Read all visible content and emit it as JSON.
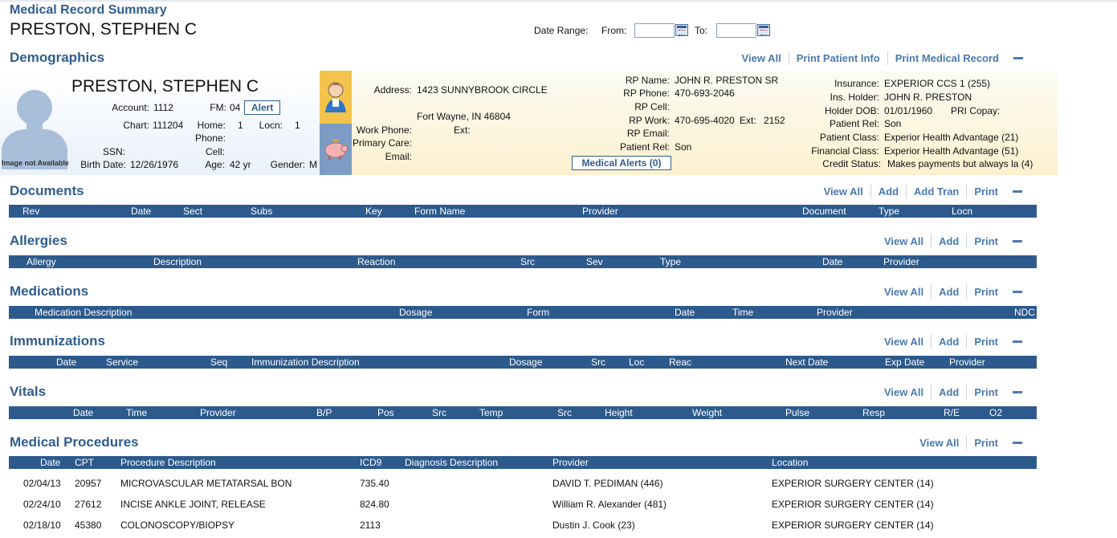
{
  "app_title": "Medical Record Summary",
  "patient_name": "PRESTON, STEPHEN C",
  "date_range": {
    "label": "Date Range:",
    "from_label": "From:",
    "to_label": "To:",
    "from_value": "",
    "to_value": ""
  },
  "demographics": {
    "title": "Demographics",
    "actions": [
      "View All",
      "Print Patient Info",
      "Print Medical Record"
    ],
    "photo_caption": "Image not Available",
    "name": "PRESTON, STEPHEN C",
    "account_label": "Account:",
    "account": "1112",
    "fm_label": "FM:",
    "fm": "04",
    "alert_button": "Alert",
    "chart_label": "Chart:",
    "chart": "111204",
    "home_phone_label": "Home:",
    "home_phone": "1",
    "phone_label": "Phone:",
    "locn_label": "Locn:",
    "locn": "1",
    "ssn_label": "SSN:",
    "ssn": "",
    "cell_label": "Cell:",
    "cell": "",
    "birth_date_label": "Birth Date:",
    "birth_date": "12/26/1976",
    "age_label": "Age:",
    "age": "42 yr",
    "gender_label": "Gender:",
    "gender": "M",
    "address_label": "Address:",
    "address_line1": "1423 SUNNYBROOK CIRCLE",
    "address_line2": "Fort Wayne, IN  46804",
    "work_phone_label": "Work Phone:",
    "work_phone": "",
    "ext_label": "Ext:",
    "ext": "",
    "primary_care_label": "Primary Care:",
    "primary_care": "",
    "email_label": "Email:",
    "email": "",
    "rp_name_label": "RP Name:",
    "rp_name": "JOHN R. PRESTON SR",
    "rp_phone_label": "RP Phone:",
    "rp_phone": "470-693-2046",
    "rp_cell_label": "RP Cell:",
    "rp_cell": "",
    "rp_work_label": "RP Work:",
    "rp_work": "470-695-4020",
    "rp_ext_label": "Ext:",
    "rp_ext": "2152",
    "rp_email_label": "RP Email:",
    "rp_email": "",
    "rp_patient_rel_label": "Patient Rel:",
    "rp_patient_rel": "Son",
    "medical_alerts_button": "Medical Alerts (0)",
    "insurance_label": "Insurance:",
    "insurance": "EXPERIOR CCS 1 (255)",
    "ins_holder_label": "Ins. Holder:",
    "ins_holder": "JOHN R. PRESTON",
    "holder_dob_label": "Holder DOB:",
    "holder_dob": "01/01/1960",
    "pri_copay_label": "PRI Copay:",
    "pri_copay": "",
    "patient_rel_label": "Patient Rel:",
    "patient_rel": "Son",
    "patient_class_label": "Patient Class:",
    "patient_class": "Experior Health Advantage (21)",
    "financial_class_label": "Financial Class:",
    "financial_class": "Experior Health Advantage (51)",
    "credit_status_label": "Credit Status:",
    "credit_status": "Makes payments but always la (4)"
  },
  "documents": {
    "title": "Documents",
    "actions": [
      "View All",
      "Add",
      "Add Tran",
      "Print"
    ],
    "columns": [
      "Rev",
      "Date",
      "Sect",
      "Subs",
      "Key",
      "Form Name",
      "Provider",
      "Document",
      "Type",
      "Locn"
    ]
  },
  "allergies": {
    "title": "Allergies",
    "actions": [
      "View All",
      "Add",
      "Print"
    ],
    "columns": [
      "Allergy",
      "Description",
      "Reaction",
      "Src",
      "Sev",
      "Type",
      "Date",
      "Provider"
    ]
  },
  "medications": {
    "title": "Medications",
    "actions": [
      "View All",
      "Add",
      "Print"
    ],
    "columns": [
      "Medication Description",
      "Dosage",
      "Form",
      "Date",
      "Time",
      "Provider",
      "NDC"
    ]
  },
  "immunizations": {
    "title": "Immunizations",
    "actions": [
      "View All",
      "Add",
      "Print"
    ],
    "columns": [
      "Date",
      "Service",
      "Seq",
      "Immunization Description",
      "Dosage",
      "Src",
      "Loc",
      "Reac",
      "Next Date",
      "Exp Date",
      "Provider"
    ]
  },
  "vitals": {
    "title": "Vitals",
    "actions": [
      "View All",
      "Add",
      "Print"
    ],
    "columns": [
      "Date",
      "Time",
      "Provider",
      "B/P",
      "Pos",
      "Src",
      "Temp",
      "Src",
      "Height",
      "Weight",
      "Pulse",
      "Resp",
      "R/E",
      "O2"
    ]
  },
  "procedures": {
    "title": "Medical Procedures",
    "actions": [
      "View All",
      "Print"
    ],
    "columns": [
      "Date",
      "CPT",
      "Procedure Description",
      "ICD9",
      "Diagnosis Description",
      "Provider",
      "Location"
    ],
    "rows": [
      [
        "02/04/13",
        "20957",
        "MICROVASCULAR METATARSAL BON",
        "735.40",
        "",
        "DAVID T. PEDIMAN (446)",
        "EXPERIOR SURGERY CENTER (14)"
      ],
      [
        "02/24/10",
        "27612",
        "INCISE ANKLE JOINT, RELEASE",
        "824.80",
        "",
        "William R. Alexander (481)",
        "EXPERIOR SURGERY CENTER (14)"
      ],
      [
        "02/18/10",
        "45380",
        "COLONOSCOPY/BIOPSY",
        "2113",
        "",
        "Dustin J. Cook (23)",
        "EXPERIOR SURGERY CENTER (14)"
      ]
    ]
  }
}
